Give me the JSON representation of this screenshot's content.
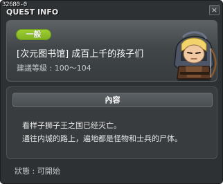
{
  "window": {
    "quest_id": "32680-0",
    "title": "QUEST INFO",
    "close_glyph": "×"
  },
  "quest": {
    "category": "一般",
    "name": "[次元图书馆] 成百上千的孩子们",
    "level_label": "建議等級 :",
    "level_range": "100～104",
    "npc_portrait_icon": "npc-hooded-warrior-icon"
  },
  "content": {
    "header": "內容",
    "lines": [
      "看样子狮子王之国已经灭亡。",
      "通往内城的路上，遍地都是怪物和士兵的尸体。"
    ]
  },
  "footer": {
    "status_label": "狀態 :",
    "status_value": "可開始"
  },
  "colors": {
    "window_bg": "#2e3134",
    "panel_bg": "#3f4447",
    "badge_green": "#8fc12a",
    "text_white": "#ffffff",
    "text_muted": "#c8cdd0"
  }
}
